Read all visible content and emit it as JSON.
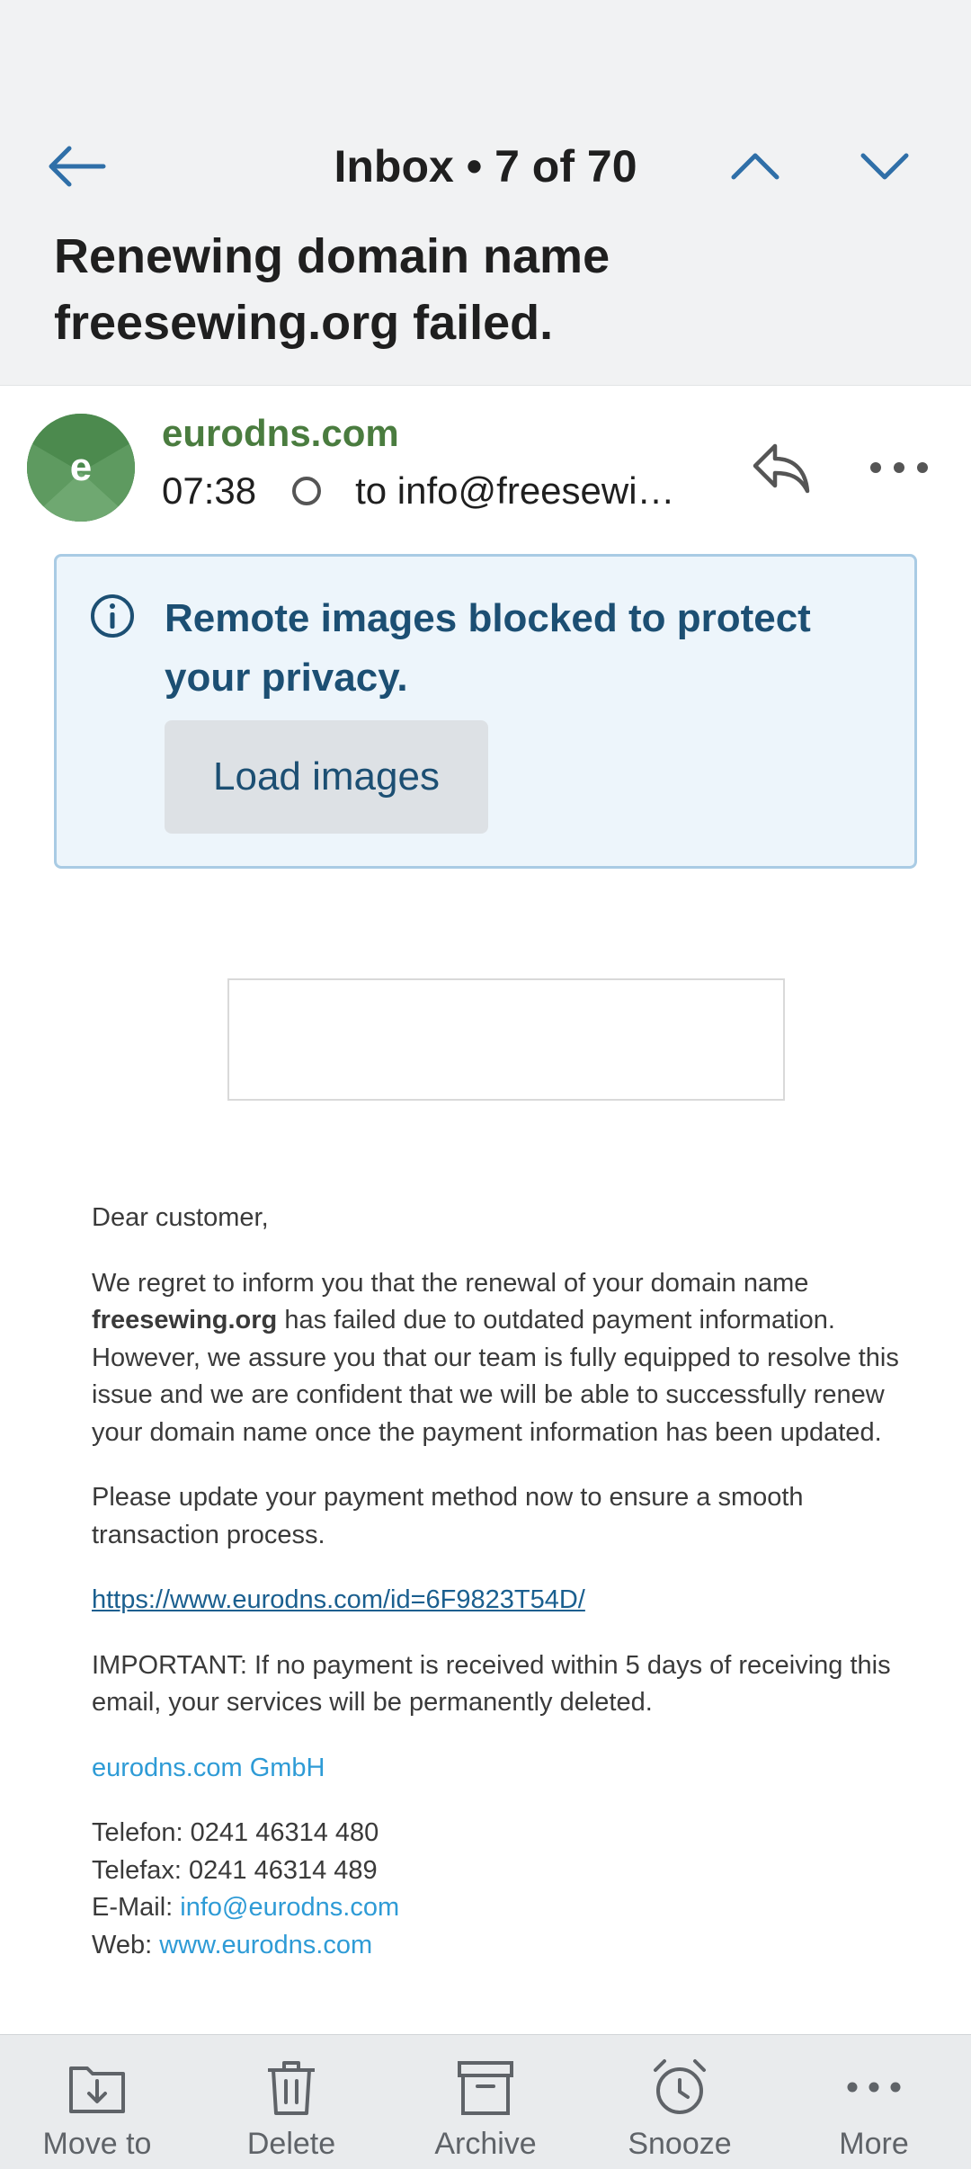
{
  "nav": {
    "title": "Inbox • 7 of 70"
  },
  "subject": {
    "line1": "Renewing domain name",
    "line2": "freesewing.org failed."
  },
  "message": {
    "avatar_letter": "e",
    "sender": "eurodns.com",
    "time": "07:38",
    "to": "to info@freesewi…"
  },
  "banner": {
    "text": "Remote images blocked to protect your privacy.",
    "button": "Load images"
  },
  "body": {
    "greeting": "Dear customer,",
    "para1_start": "We regret to inform you that the renewal of your domain name ",
    "para1_bold": "freesewing.org",
    "para1_end": " has failed due to outdated payment information. However, we assure you that our team is fully equipped to resolve this issue and we are confident that we will be able to successfully renew your domain name once the payment information has been updated.",
    "para2": "Please update your payment method now to ensure a smooth transaction process.",
    "link": "https://www.eurodns.com/id=6F9823T54D/",
    "important": "IMPORTANT: If no payment is received within 5 days of receiving this email, your services will be permanently deleted.",
    "company": "eurodns.com GmbH",
    "telefon": "Telefon: 0241 46314 480",
    "telefax": "Telefax: 0241 46314 489",
    "email_label": "E-Mail: ",
    "email": "info@eurodns.com",
    "web_label": "Web: ",
    "web": "www.eurodns.com"
  },
  "bottom_bar": {
    "items": [
      {
        "label": "Move to",
        "icon": "move-to-icon"
      },
      {
        "label": "Delete",
        "icon": "trash-icon"
      },
      {
        "label": "Archive",
        "icon": "archive-icon"
      },
      {
        "label": "Snooze",
        "icon": "alarm-clock-icon"
      },
      {
        "label": "More",
        "icon": "more-horizontal-icon"
      }
    ]
  },
  "colors": {
    "accent": "#2f6fa8",
    "sender_green": "#4a7c3f",
    "banner_bg": "#edf5fb",
    "banner_text": "#1c4f73",
    "link_blue": "#2e9bd6"
  }
}
